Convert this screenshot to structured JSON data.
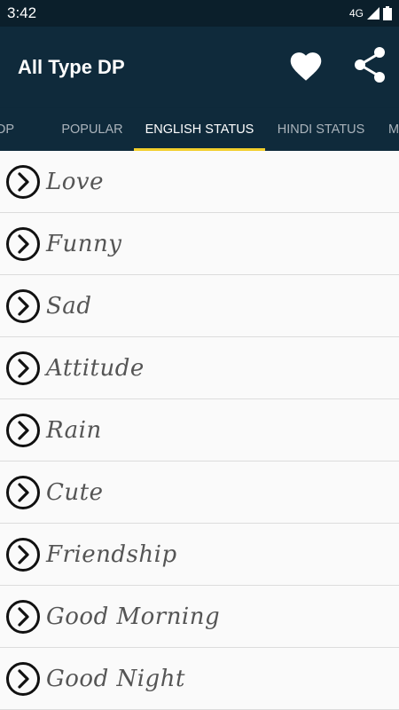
{
  "status_bar": {
    "time": "3:42",
    "network": "4G"
  },
  "app_bar": {
    "title": "All Type DP",
    "favorite_icon": "heart-icon",
    "share_icon": "share-icon"
  },
  "tabs": [
    {
      "label": "DP",
      "active": false
    },
    {
      "label": "POPULAR",
      "active": false
    },
    {
      "label": "ENGLISH STATUS",
      "active": true
    },
    {
      "label": "HINDI STATUS",
      "active": false
    },
    {
      "label": "M",
      "active": false
    }
  ],
  "categories": [
    {
      "label": "Love"
    },
    {
      "label": "Funny"
    },
    {
      "label": "Sad"
    },
    {
      "label": "Attitude"
    },
    {
      "label": "Rain"
    },
    {
      "label": "Cute"
    },
    {
      "label": "Friendship"
    },
    {
      "label": "Good Morning"
    },
    {
      "label": "Good Night"
    }
  ],
  "colors": {
    "app_bar": "#0f2a3b",
    "status_bar": "#0b1f2b",
    "tab_indicator": "#f2cf2c",
    "list_background": "#fafafa"
  }
}
